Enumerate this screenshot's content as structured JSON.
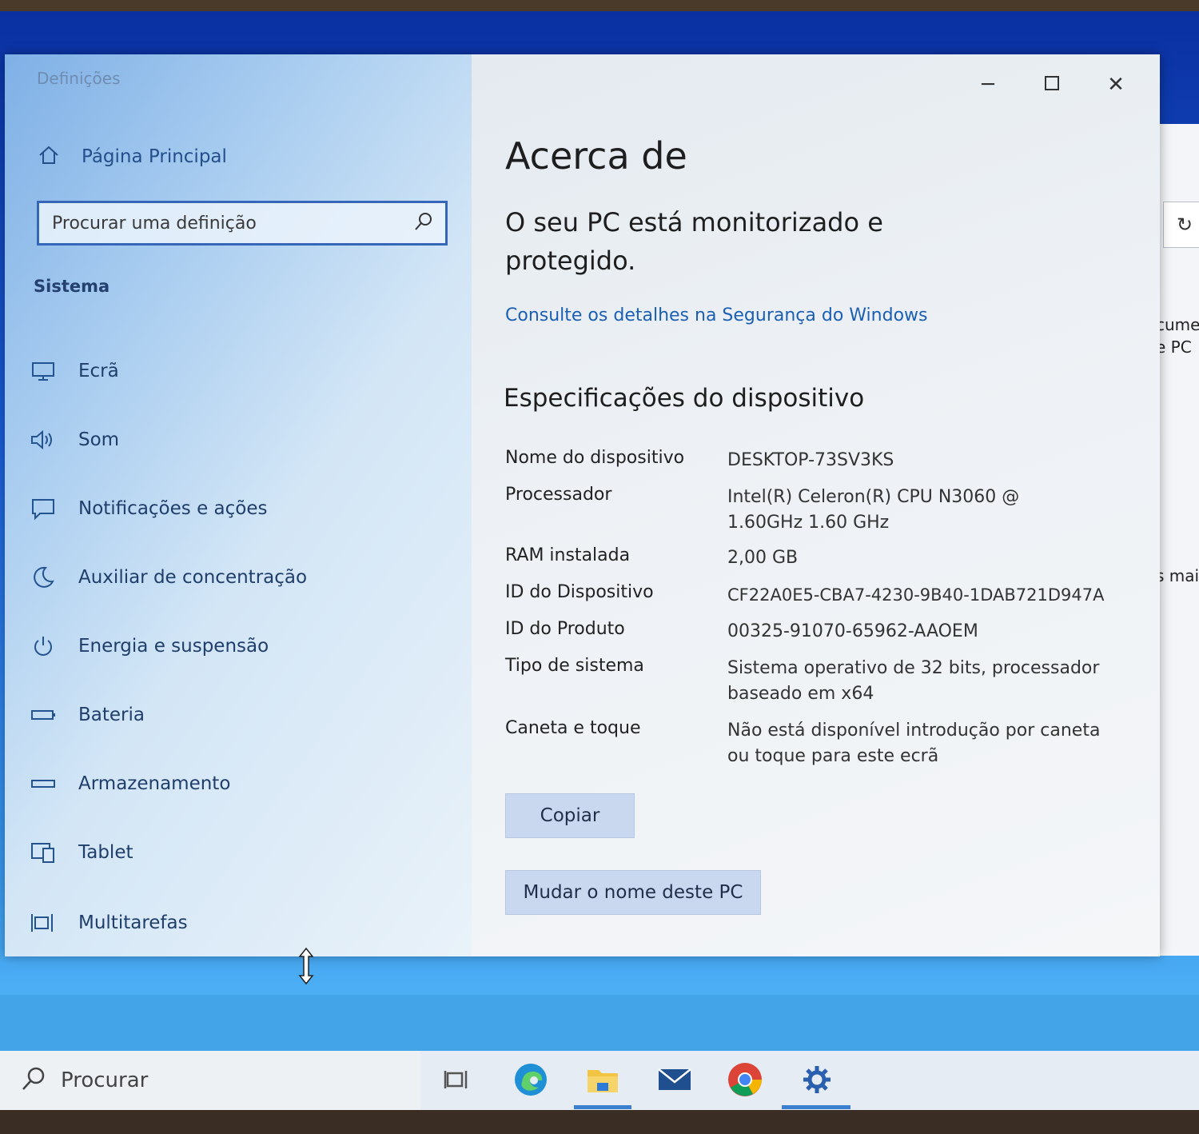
{
  "window": {
    "title": "Definições"
  },
  "sidebar": {
    "home_label": "Página Principal",
    "search_placeholder": "Procurar uma definição",
    "section_title": "Sistema",
    "items": [
      {
        "label": "Ecrã",
        "icon": "monitor-icon"
      },
      {
        "label": "Som",
        "icon": "speaker-icon"
      },
      {
        "label": "Notificações e ações",
        "icon": "notification-icon"
      },
      {
        "label": "Auxiliar de concentração",
        "icon": "moon-icon"
      },
      {
        "label": "Energia e suspensão",
        "icon": "power-icon"
      },
      {
        "label": "Bateria",
        "icon": "battery-icon"
      },
      {
        "label": "Armazenamento",
        "icon": "storage-icon"
      },
      {
        "label": "Tablet",
        "icon": "tablet-icon"
      },
      {
        "label": "Multitarefas",
        "icon": "multitask-icon"
      }
    ]
  },
  "main": {
    "title": "Acerca de",
    "protection_status": "O seu PC está monitorizado e protegido.",
    "security_link": "Consulte os detalhes na Segurança do Windows",
    "specs_title": "Especificações do dispositivo",
    "specs": [
      {
        "key": "Nome do dispositivo",
        "value": "DESKTOP-73SV3KS"
      },
      {
        "key": "Processador",
        "value": "Intel(R) Celeron(R) CPU  N3060  @ 1.60GHz 1.60 GHz"
      },
      {
        "key": "RAM instalada",
        "value": "2,00 GB"
      },
      {
        "key": "ID do Dispositivo",
        "value": "CF22A0E5-CBA7-4230-9B40-1DAB721D947A"
      },
      {
        "key": "ID do Produto",
        "value": "00325-91070-65962-AAOEM"
      },
      {
        "key": "Tipo de sistema",
        "value": "Sistema operativo de 32 bits, processador baseado em x64"
      },
      {
        "key": "Caneta e toque",
        "value": "Não está disponível introdução por caneta ou toque para este ecrã"
      }
    ],
    "copy_button": "Copiar",
    "rename_button": "Mudar o nome deste PC"
  },
  "background_window": {
    "text_1": "cumen",
    "text_2": "e PC",
    "text_3": "s mai"
  },
  "taskbar": {
    "search_label": "Procurar",
    "apps": [
      "task-view-icon",
      "edge-icon",
      "file-explorer-icon",
      "mail-icon",
      "chrome-icon",
      "settings-gear-icon"
    ]
  },
  "colors": {
    "accent": "#1a5fb4",
    "taskbar": "#44a4e8",
    "sidebar": "#a9cdf0"
  }
}
